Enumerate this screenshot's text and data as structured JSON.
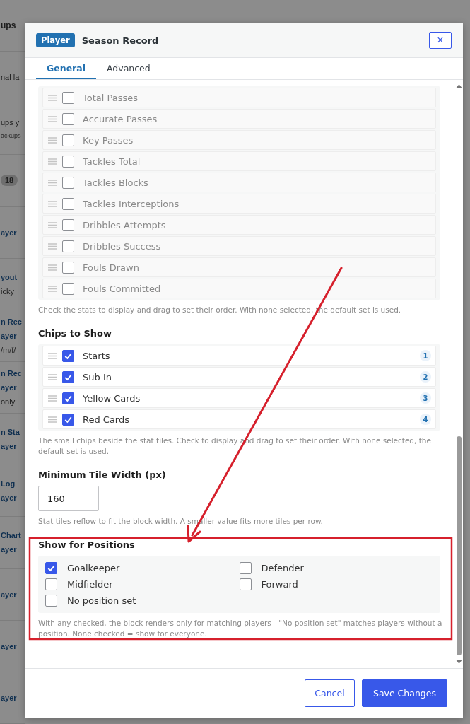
{
  "background": {
    "rows": [
      {
        "lines": [
          {
            "text": "ups",
            "kind": "heading"
          }
        ]
      },
      {
        "lines": [
          {
            "text": "nal la",
            "kind": "text"
          }
        ]
      },
      {
        "lines": [
          {
            "text": "ups y",
            "kind": "text"
          },
          {
            "text": "ackups",
            "kind": "small"
          }
        ]
      },
      {
        "lines": [
          {
            "text": "18",
            "kind": "badge"
          }
        ]
      },
      {
        "lines": [
          {
            "text": "ayer",
            "kind": "link"
          }
        ]
      },
      {
        "lines": [
          {
            "text": "yout",
            "kind": "link"
          },
          {
            "text": "icky",
            "kind": "text"
          }
        ]
      },
      {
        "lines": [
          {
            "text": "n Rec",
            "kind": "link"
          },
          {
            "text": "ayer",
            "kind": "link"
          },
          {
            "text": "/m/f/",
            "kind": "text"
          }
        ]
      },
      {
        "lines": [
          {
            "text": "n Rec",
            "kind": "link"
          },
          {
            "text": "ayer",
            "kind": "link"
          },
          {
            "text": "only",
            "kind": "text"
          }
        ]
      },
      {
        "lines": [
          {
            "text": "n Sta",
            "kind": "link"
          },
          {
            "text": "ayer",
            "kind": "link"
          }
        ]
      },
      {
        "lines": [
          {
            "text": "Log",
            "kind": "link"
          },
          {
            "text": "ayer",
            "kind": "link"
          }
        ]
      },
      {
        "lines": [
          {
            "text": "Chart",
            "kind": "link"
          },
          {
            "text": "ayer",
            "kind": "link"
          }
        ]
      },
      {
        "lines": [
          {
            "text": "ayer",
            "kind": "link"
          }
        ]
      },
      {
        "lines": [
          {
            "text": "ayer",
            "kind": "link"
          }
        ]
      },
      {
        "lines": [
          {
            "text": "ayer",
            "kind": "link"
          }
        ]
      }
    ]
  },
  "modal": {
    "badge": "Player",
    "title": "Season Record",
    "close": "×",
    "tabs": [
      {
        "label": "General",
        "selected": true
      },
      {
        "label": "Advanced",
        "selected": false
      }
    ],
    "stats": {
      "items": [
        {
          "label": "Total Passes",
          "checked": false
        },
        {
          "label": "Accurate Passes",
          "checked": false
        },
        {
          "label": "Key Passes",
          "checked": false
        },
        {
          "label": "Tackles Total",
          "checked": false
        },
        {
          "label": "Tackles Blocks",
          "checked": false
        },
        {
          "label": "Tackles Interceptions",
          "checked": false
        },
        {
          "label": "Dribbles Attempts",
          "checked": false
        },
        {
          "label": "Dribbles Success",
          "checked": false
        },
        {
          "label": "Fouls Drawn",
          "checked": false
        },
        {
          "label": "Fouls Committed",
          "checked": false
        }
      ],
      "hint": "Check the stats to display and drag to set their order. With none selected, the default set is used."
    },
    "chips": {
      "heading": "Chips to Show",
      "items": [
        {
          "label": "Starts",
          "checked": true,
          "order": "1"
        },
        {
          "label": "Sub In",
          "checked": true,
          "order": "2"
        },
        {
          "label": "Yellow Cards",
          "checked": true,
          "order": "3"
        },
        {
          "label": "Red Cards",
          "checked": true,
          "order": "4"
        }
      ],
      "hint": "The small chips beside the stat tiles. Check to display and drag to set their order. With none selected, the default set is used."
    },
    "tile_width": {
      "label": "Minimum Tile Width (px)",
      "value": "160",
      "hint": "Stat tiles reflow to fit the block width. A smaller value fits more tiles per row."
    },
    "positions": {
      "heading": "Show for Positions",
      "items": [
        {
          "label": "Goalkeeper",
          "checked": true
        },
        {
          "label": "Defender",
          "checked": false
        },
        {
          "label": "Midfielder",
          "checked": false
        },
        {
          "label": "Forward",
          "checked": false
        },
        {
          "label": "No position set",
          "checked": false
        }
      ],
      "hint": "With any checked, the block renders only for matching players - \"No position set\" matches players without a position. None checked = show for everyone."
    },
    "buttons": [
      {
        "label": "Cancel",
        "kind": "secondary"
      },
      {
        "label": "Save Changes",
        "kind": "primary"
      }
    ]
  }
}
